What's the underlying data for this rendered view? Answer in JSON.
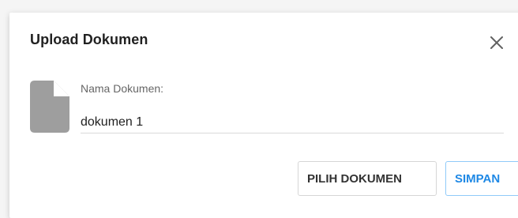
{
  "dialog": {
    "title": "Upload Dokumen",
    "close_icon": "close-icon",
    "document_icon": "file-icon",
    "field": {
      "label": "Nama Dokumen:",
      "value": "dokumen 1"
    },
    "buttons": {
      "choose_label": "PILIH DOKUMEN",
      "save_label": "SIMPAN"
    }
  },
  "colors": {
    "accent": "#1e88e5",
    "icon_gray": "#9e9e9e"
  }
}
